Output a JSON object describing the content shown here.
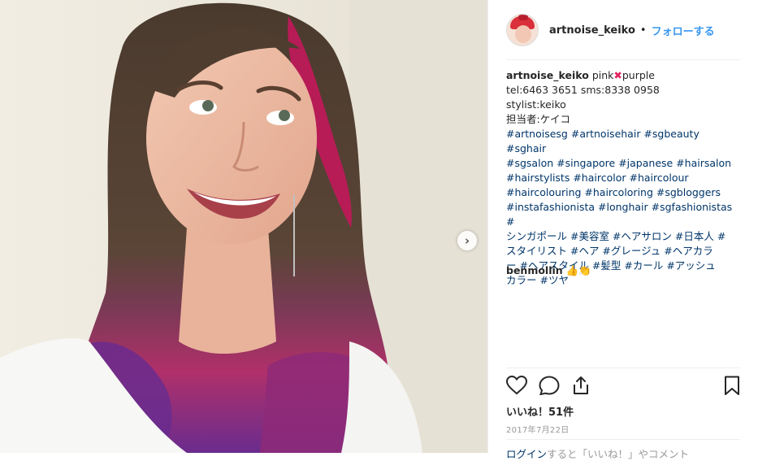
{
  "photo": {
    "next_icon": "chevron-right-icon"
  },
  "header": {
    "username": "artnoise_keiko",
    "separator": "•",
    "follow_label": "フォローする"
  },
  "caption": {
    "username": "artnoise_keiko",
    "title_pre": "pink",
    "title_cross": "✖",
    "title_post": "purple",
    "line_tel": "tel:6463 3651 sms:8338 0958",
    "line_stylist": "stylist:keiko",
    "line_tantou": "担当者:ケイコ",
    "hashtag_lines": [
      "#artnoisesg #artnoisehair #sgbeauty #sghair",
      "#sgsalon #singapore #japanese #hairsalon",
      "#hairstylists #haircolor #haircolour",
      "#haircolouring #haircoloring #sgbloggers",
      "#instafashionista #longhair #sgfashionistas #",
      "シンガポール #美容室 #ヘアサロン #日本人 #",
      "スタイリスト  #ヘア #グレージュ #ヘアカラ",
      "ー  #ヘアスタイル #髪型 #カール #アッシュ",
      "カラー #ツヤ"
    ]
  },
  "comment": {
    "username": "benmollin",
    "text": "👍👏"
  },
  "actions": {
    "like_icon": "heart-icon",
    "comment_icon": "comment-icon",
    "share_icon": "share-icon",
    "save_icon": "bookmark-icon"
  },
  "likes_text": "いいね！51件",
  "date_text": "2017年7月22日",
  "login_prompt": {
    "login": "ログイン",
    "rest": "すると「いいね！」やコメント"
  },
  "colors": {
    "link": "#003569",
    "follow": "#3897f0",
    "hair_pink": "#c2185b",
    "hair_purple": "#6a2c8e"
  }
}
